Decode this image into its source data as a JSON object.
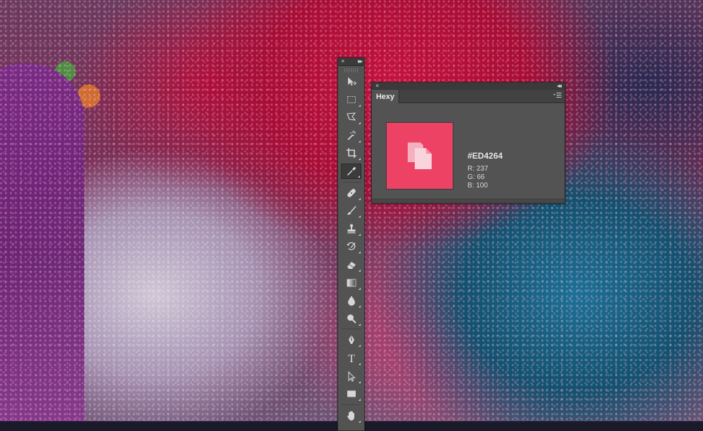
{
  "toolbar": {
    "close_glyph": "×",
    "collapse_glyph": "▸▸",
    "tools": [
      {
        "icon": "move-icon",
        "name": "move-tool"
      },
      {
        "icon": "marquee-icon",
        "name": "rectangular-marquee-tool"
      },
      {
        "icon": "lasso-icon",
        "name": "lasso-tool"
      },
      {
        "icon": "magic-wand-icon",
        "name": "magic-wand-tool"
      },
      {
        "icon": "crop-icon",
        "name": "crop-tool"
      },
      {
        "icon": "eyedropper-icon",
        "name": "eyedropper-tool",
        "active": true
      },
      {
        "icon": "healing-brush-icon",
        "name": "spot-healing-brush-tool"
      },
      {
        "icon": "brush-icon",
        "name": "brush-tool"
      },
      {
        "icon": "stamp-icon",
        "name": "clone-stamp-tool"
      },
      {
        "icon": "history-brush-icon",
        "name": "history-brush-tool"
      },
      {
        "icon": "eraser-icon",
        "name": "eraser-tool"
      },
      {
        "icon": "gradient-icon",
        "name": "gradient-tool"
      },
      {
        "icon": "blur-icon",
        "name": "blur-tool"
      },
      {
        "icon": "dodge-icon",
        "name": "dodge-tool"
      },
      {
        "icon": "pen-icon",
        "name": "pen-tool"
      },
      {
        "icon": "type-icon",
        "name": "type-tool"
      },
      {
        "icon": "path-selection-icon",
        "name": "path-selection-tool"
      },
      {
        "icon": "rectangle-shape-icon",
        "name": "rectangle-tool"
      },
      {
        "icon": "hand-icon",
        "name": "hand-tool"
      }
    ]
  },
  "panel": {
    "close_glyph": "×",
    "collapse_glyph": "◂◂",
    "tab_label": "Hexy",
    "menu_icon": "panel-menu-icon",
    "swatch_color": "#ED4264",
    "swatch_icon": "copy-documents-icon",
    "hex_value": "#ED4264",
    "rgb": {
      "r": "R: 237",
      "g": "G: 66",
      "b": "B: 100"
    }
  }
}
